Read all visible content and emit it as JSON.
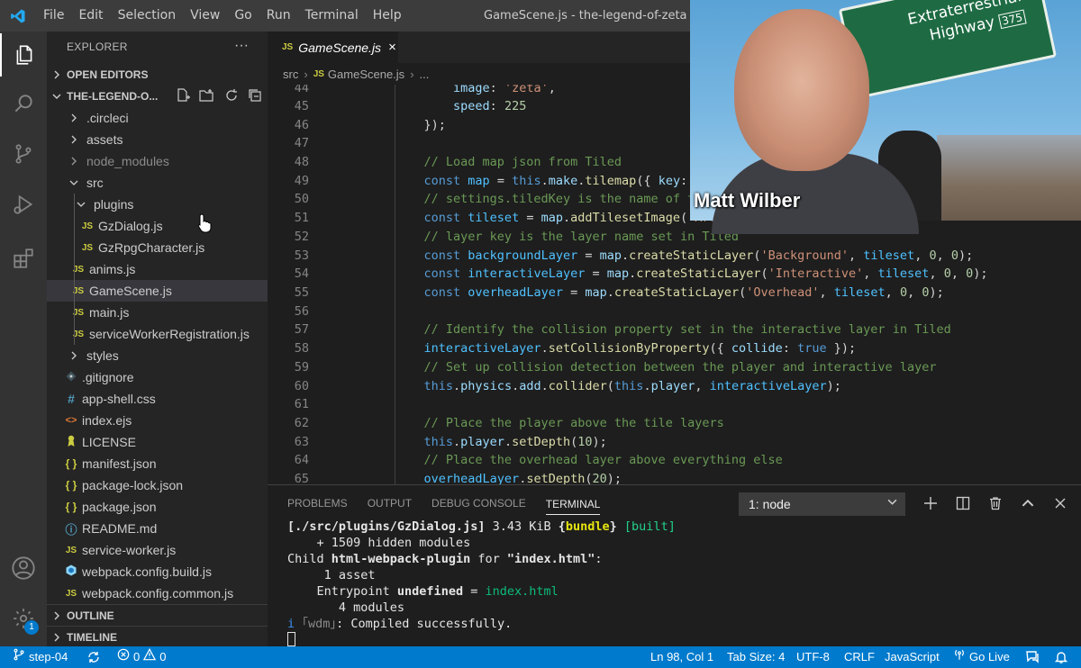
{
  "titlebar": {
    "menu": [
      "File",
      "Edit",
      "Selection",
      "View",
      "Go",
      "Run",
      "Terminal",
      "Help"
    ],
    "title": "GameScene.js - the-legend-of-zeta - Vis"
  },
  "sidebar": {
    "title": "EXPLORER",
    "more": "···",
    "open_editors": "OPEN EDITORS",
    "project": "THE-LEGEND-O...",
    "tree": [
      {
        "label": ".circleci",
        "type": "folder"
      },
      {
        "label": "assets",
        "type": "folder"
      },
      {
        "label": "node_modules",
        "type": "folder"
      },
      {
        "label": "src",
        "type": "folder-open"
      },
      {
        "label": "plugins",
        "type": "folder-open"
      },
      {
        "label": "GzDialog.js",
        "type": "js"
      },
      {
        "label": "GzRpgCharacter.js",
        "type": "js"
      },
      {
        "label": "anims.js",
        "type": "js"
      },
      {
        "label": "GameScene.js",
        "type": "js"
      },
      {
        "label": "main.js",
        "type": "js"
      },
      {
        "label": "serviceWorkerRegistration.js",
        "type": "js"
      },
      {
        "label": "styles",
        "type": "folder"
      },
      {
        "label": ".gitignore",
        "type": "git"
      },
      {
        "label": "app-shell.css",
        "type": "css"
      },
      {
        "label": "index.ejs",
        "type": "ejs"
      },
      {
        "label": "LICENSE",
        "type": "license"
      },
      {
        "label": "manifest.json",
        "type": "json"
      },
      {
        "label": "package-lock.json",
        "type": "json"
      },
      {
        "label": "package.json",
        "type": "json"
      },
      {
        "label": "README.md",
        "type": "info"
      },
      {
        "label": "service-worker.js",
        "type": "js"
      },
      {
        "label": "webpack.config.build.js",
        "type": "webpack"
      },
      {
        "label": "webpack.config.common.js",
        "type": "js"
      }
    ],
    "outline": "OUTLINE",
    "timeline": "TIMELINE",
    "icon_labels": {
      "js": "JS",
      "css": "#",
      "json": "{ }",
      "ejs": "<>",
      "info": "ⓘ"
    }
  },
  "editor": {
    "tab_lang": "JS",
    "tab_name": "GameScene.js",
    "tab_close": "×",
    "breadcrumb": {
      "folder": "src",
      "file": "GameScene.js",
      "more": "..."
    },
    "line_numbers": [
      "44",
      "45",
      "46",
      "47",
      "48",
      "49",
      "50",
      "51",
      "52",
      "53",
      "54",
      "55",
      "56",
      "57",
      "58",
      "59",
      "60",
      "61",
      "62",
      "63",
      "64",
      "65"
    ]
  },
  "panel": {
    "tabs": [
      "PROBLEMS",
      "OUTPUT",
      "DEBUG CONSOLE",
      "TERMINAL"
    ],
    "active_tab": "TERMINAL",
    "terminal_select": "1: node",
    "terminal": {
      "l1_path": "[./src/plugins/GzDialog.js]",
      "l1_size": " 3.43 KiB ",
      "l1_open": "{",
      "l1_bundle": "bundle",
      "l1_close": "}",
      "l1_built": " [built]",
      "l2": "    + 1509 hidden modules",
      "l3_pre": "Child ",
      "l3_plugin": "html-webpack-plugin",
      "l3_for": " for ",
      "l3_str": "\"index.html\"",
      "l3_colon": ":",
      "l4": "     1 asset",
      "l5_pre": "    Entrypoint ",
      "l5_undef": "undefined",
      "l5_eq": " = ",
      "l5_file": "index.html",
      "l6": "       4 modules",
      "l7_i": "i",
      "l7_wdm": " ｢wdm｣",
      "l7_msg": ": Compiled successfully."
    }
  },
  "statusbar": {
    "branch": "step-04",
    "errors": "0",
    "warnings": "0",
    "position": "Ln 98, Col 1",
    "tab_size": "Tab Size: 4",
    "encoding": "UTF-8",
    "eol": "CRLF",
    "language": "JavaScript",
    "live": "Go Live"
  },
  "activity": {
    "extensions_badge": "1"
  },
  "webcam": {
    "name": "Matt Wilber",
    "sign_line1": "Extraterrestrial",
    "sign_line2": "Highway",
    "sign_route": "375"
  },
  "colors": {
    "accent": "#007acc",
    "editor_bg": "#1e1e1e",
    "sidebar_bg": "#252526"
  }
}
